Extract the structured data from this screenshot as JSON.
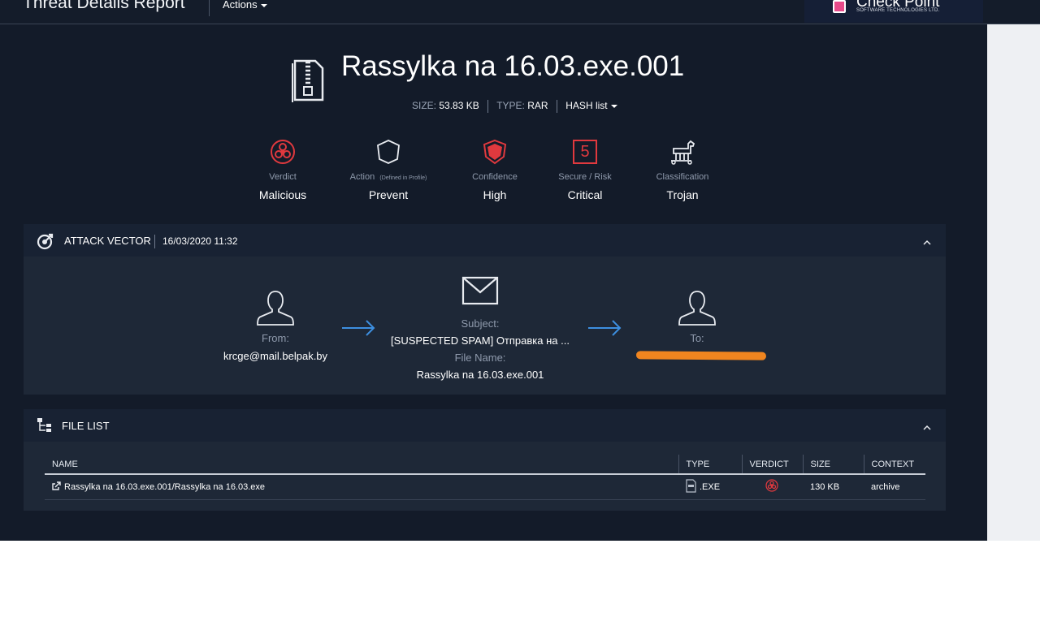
{
  "header": {
    "app_title": "Threat Details Report",
    "actions_label": "Actions",
    "logo_name": "Check Point",
    "logo_sub": "SOFTWARE TECHNOLOGIES LTD."
  },
  "file": {
    "name": "Rassylka na 16.03.exe.001",
    "size_label": "SIZE:",
    "size": "53.83 KB",
    "type_label": "TYPE:",
    "type": "RAR",
    "hash_label": "HASH list"
  },
  "summary": [
    {
      "label": "Verdict",
      "value": "Malicious",
      "icon": "biohazard-icon"
    },
    {
      "label": "Action",
      "label_note": "(Defined in Profile)",
      "value": "Prevent",
      "icon": "shield-outline-icon"
    },
    {
      "label": "Confidence",
      "value": "High",
      "icon": "shield-filled-icon"
    },
    {
      "label": "Secure / Risk",
      "value": "Critical",
      "badge": "5",
      "icon": "risk-level-icon"
    },
    {
      "label": "Classification",
      "value": "Trojan",
      "icon": "trojan-horse-icon"
    }
  ],
  "attack_vector": {
    "title": "ATTACK VECTOR",
    "date": "16/03/2020 11:32",
    "from_label": "From:",
    "from_value": "krcge@mail.belpak.by",
    "subject_label": "Subject:",
    "subject_value": "[SUSPECTED SPAM] Отправка на ...",
    "filename_label": "File Name:",
    "filename_value": "Rassylka na 16.03.exe.001",
    "to_label": "To:"
  },
  "file_list": {
    "title": "FILE LIST",
    "columns": [
      "NAME",
      "TYPE",
      "VERDICT",
      "SIZE",
      "CONTEXT"
    ],
    "rows": [
      {
        "name": "Rassylka na 16.03.exe.001/Rassylka na 16.03.exe",
        "type": ".EXE",
        "size": "130 KB",
        "context": "archive"
      }
    ]
  },
  "colors": {
    "background": "#131b29",
    "panel": "#1e2837",
    "danger": "#e0393e",
    "accent": "#3d8fe0",
    "redaction": "#f0851f"
  }
}
